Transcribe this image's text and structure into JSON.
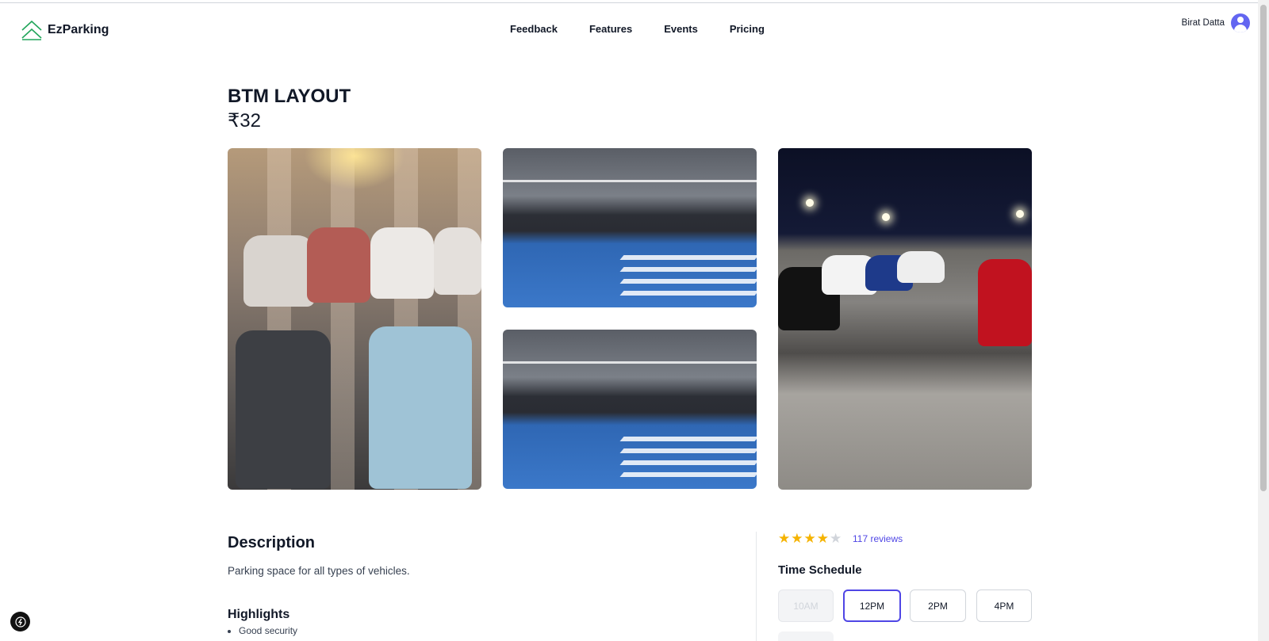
{
  "header": {
    "brand": "EzParking",
    "nav": [
      "Feedback",
      "Features",
      "Events",
      "Pricing"
    ],
    "user_name": "Birat Datta"
  },
  "listing": {
    "title": "BTM LAYOUT",
    "price": "₹32",
    "images": [
      "parking-lot-sunset-photo",
      "indoor-parking-garage-photo",
      "indoor-parking-garage-photo",
      "outdoor-parking-lot-night-photo"
    ]
  },
  "description": {
    "heading": "Description",
    "text": "Parking space for all types of vehicles."
  },
  "highlights": {
    "heading": "Highlights",
    "items": [
      "Good security"
    ]
  },
  "rating": {
    "stars": 4,
    "max": 5,
    "reviews_label": "117 reviews"
  },
  "schedule": {
    "heading": "Time Schedule",
    "slots": [
      {
        "label": "10AM",
        "state": "disabled"
      },
      {
        "label": "12PM",
        "state": "selected"
      },
      {
        "label": "2PM",
        "state": "available"
      },
      {
        "label": "4PM",
        "state": "available"
      }
    ]
  },
  "colors": {
    "accent": "#4f46e5",
    "star": "#f5b301",
    "logo": "#22a55b"
  }
}
